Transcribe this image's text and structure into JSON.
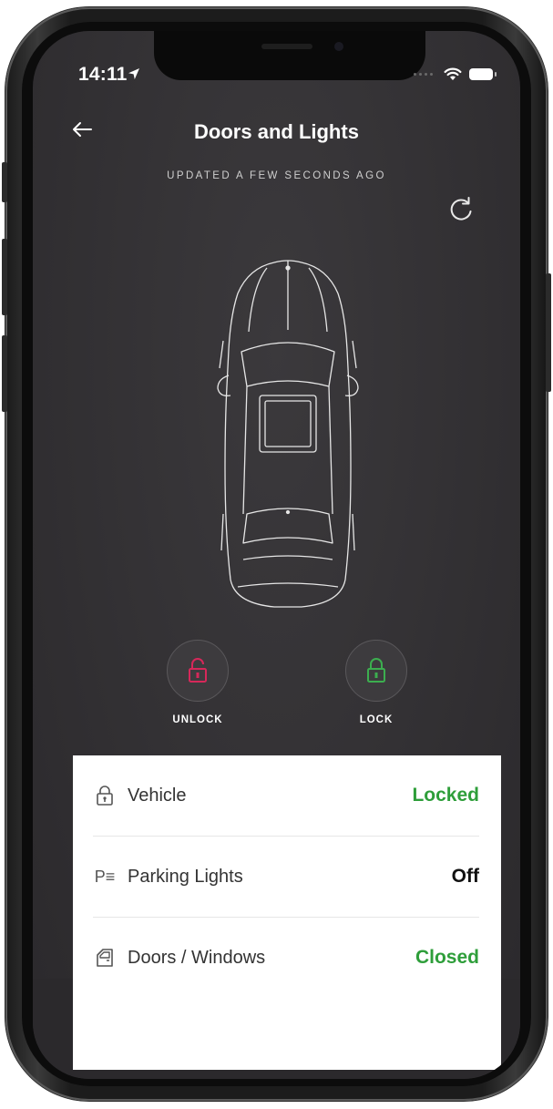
{
  "status_bar": {
    "time": "14:11",
    "icons": [
      "location-arrow-icon",
      "wifi-icon",
      "battery-icon"
    ]
  },
  "header": {
    "title": "Doors and Lights",
    "updated": "UPDATED A FEW SECONDS AGO"
  },
  "actions": {
    "unlock_label": "UNLOCK",
    "lock_label": "LOCK",
    "unlock_color": "#d6285a",
    "lock_color": "#3cae4f"
  },
  "status": {
    "rows": [
      {
        "icon": "lock-icon",
        "label": "Vehicle",
        "value": "Locked",
        "value_color": "#2e9e3a"
      },
      {
        "icon": "parking-lights-icon",
        "label": "Parking Lights",
        "value": "Off",
        "value_color": "#111111"
      },
      {
        "icon": "door-icon",
        "label": "Doors / Windows",
        "value": "Closed",
        "value_color": "#2e9e3a"
      }
    ],
    "parking_icon_text": "P≡"
  }
}
